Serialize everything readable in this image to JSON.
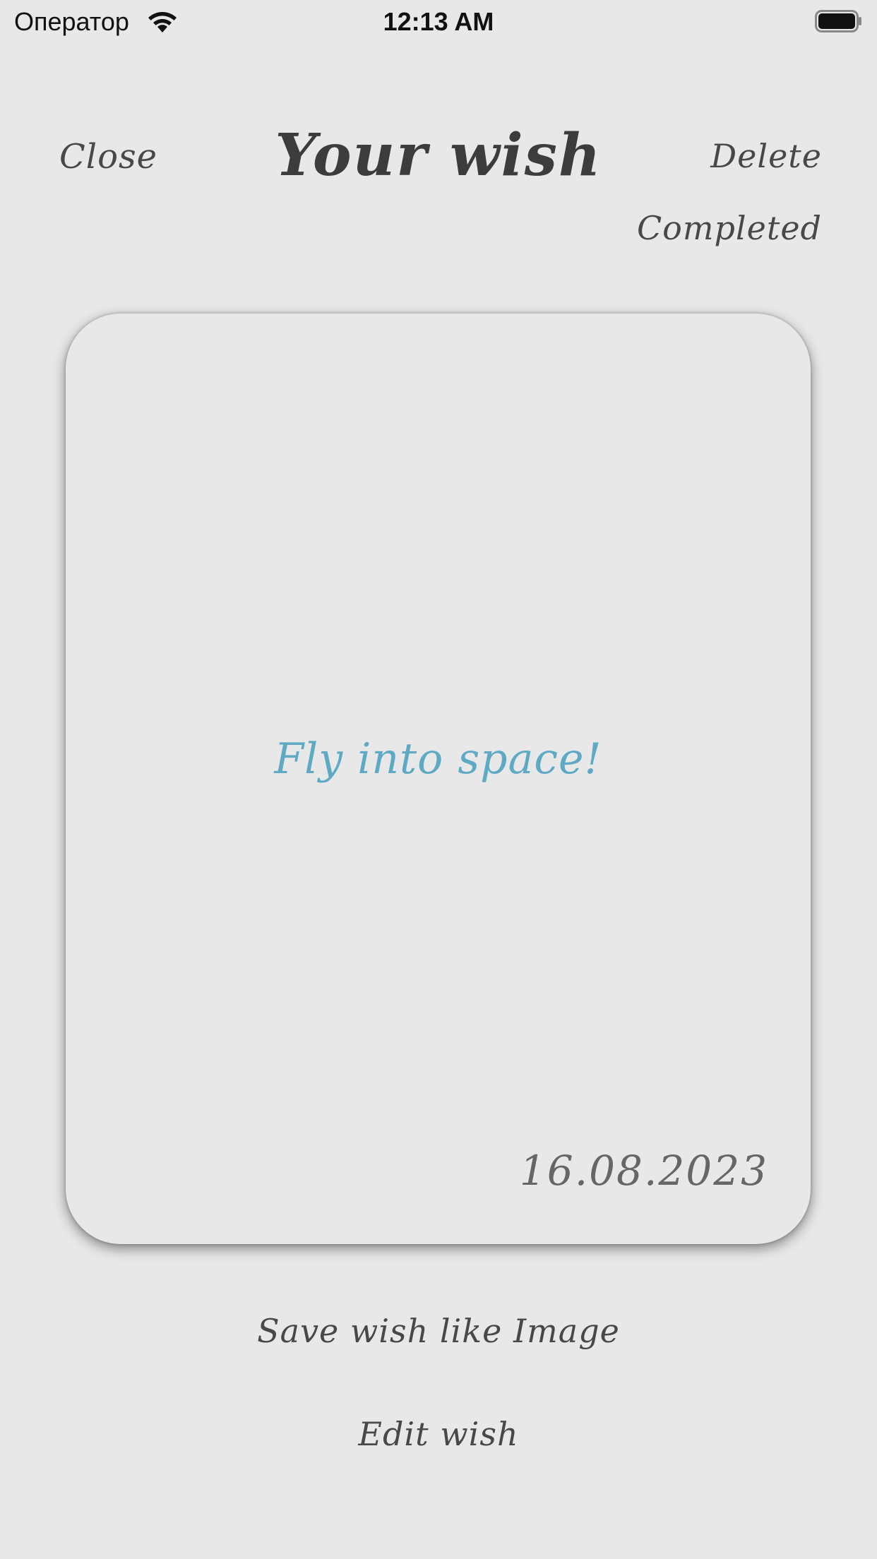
{
  "status_bar": {
    "carrier": "Оператор",
    "time": "12:13 AM",
    "icons": [
      "wifi-icon",
      "battery-icon"
    ]
  },
  "header": {
    "close_label": "Close",
    "title": "Your wish",
    "delete_label": "Delete",
    "completed_label": "Completed"
  },
  "card": {
    "wish_text": "Fly into space!",
    "date": "16.08.2023",
    "wish_color": "#5ea9c4"
  },
  "actions": {
    "save_label": "Save wish like Image",
    "edit_label": "Edit wish"
  }
}
